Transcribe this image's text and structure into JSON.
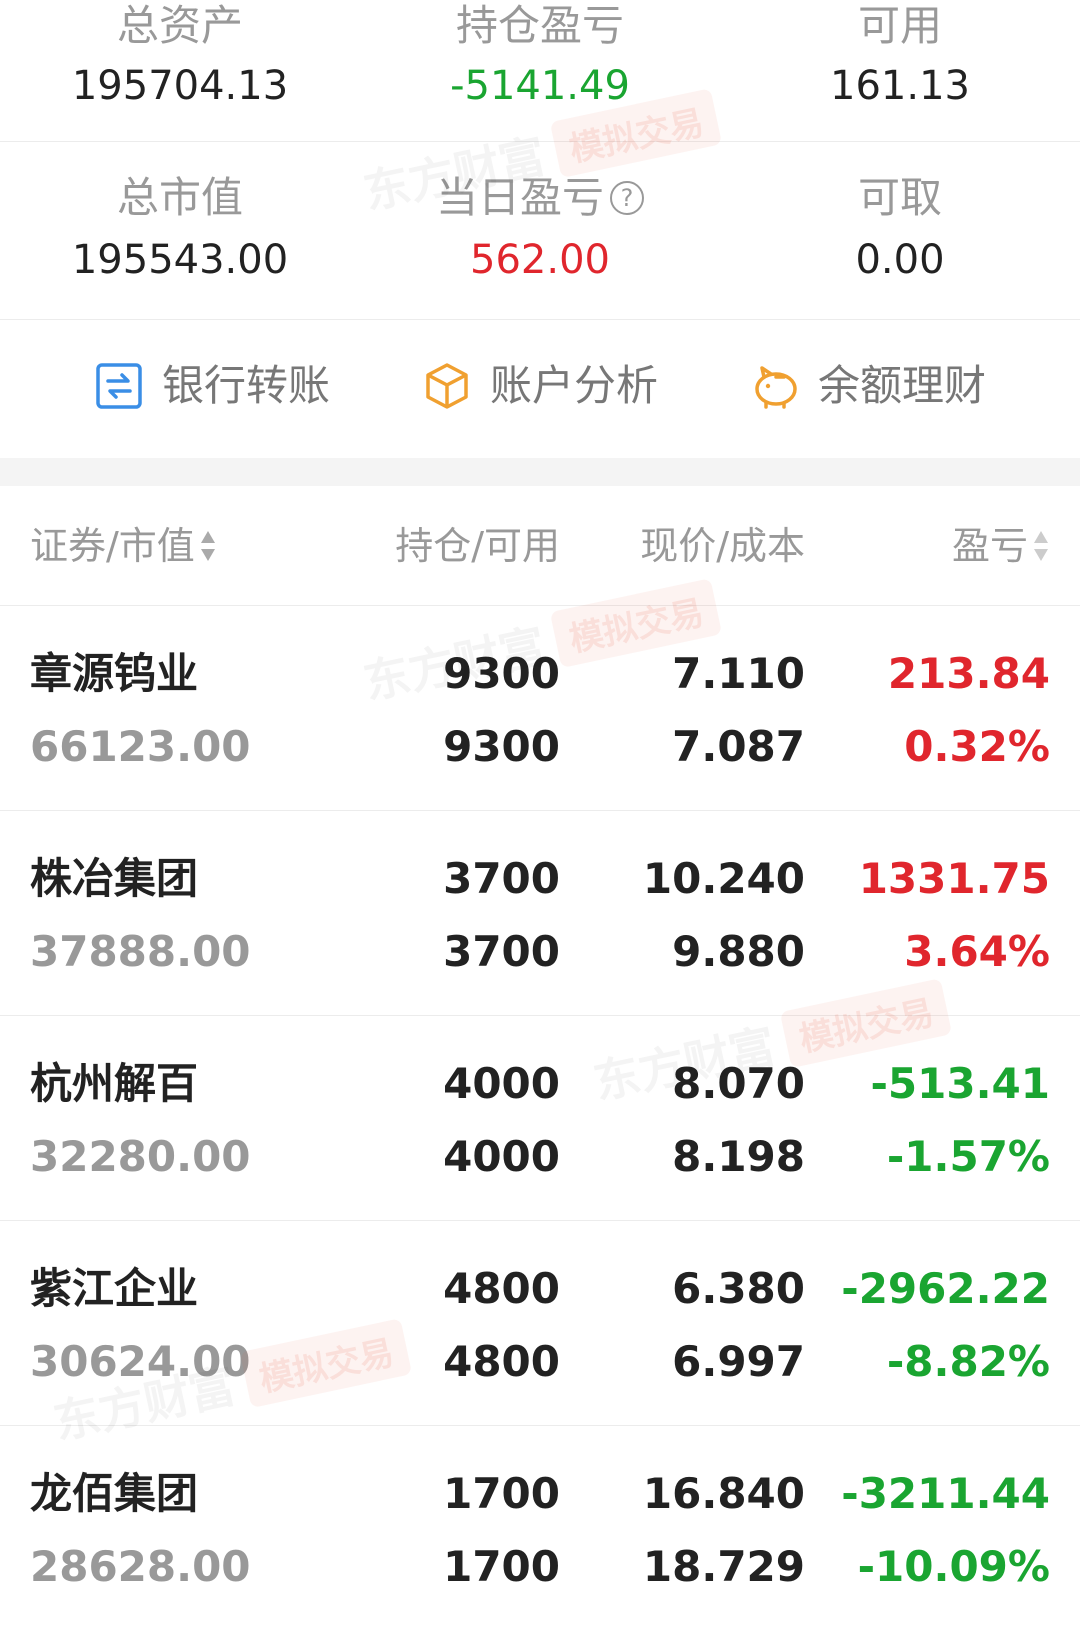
{
  "summary": {
    "total_assets": {
      "label": "总资产",
      "value": "195704.13"
    },
    "position_pnl": {
      "label": "持仓盈亏",
      "value": "-5141.49",
      "color": "#1aa531"
    },
    "available": {
      "label": "可用",
      "value": "161.13"
    },
    "total_market_value": {
      "label": "总市值",
      "value": "195543.00"
    },
    "daily_pnl": {
      "label": "当日盈亏",
      "value": "562.00",
      "color": "#e0262d",
      "icon": "help-icon"
    },
    "withdrawable": {
      "label": "可取",
      "value": "0.00"
    }
  },
  "actions": [
    {
      "label": "银行转账",
      "icon": "bank-transfer-icon",
      "color": "#3a8ee6"
    },
    {
      "label": "账户分析",
      "icon": "cube-icon",
      "color": "#f0a030"
    },
    {
      "label": "余额理财",
      "icon": "piggy-bank-icon",
      "color": "#f0a030"
    }
  ],
  "table": {
    "headers": {
      "security": "证券/市值",
      "position": "持仓/可用",
      "price": "现价/成本",
      "pnl": "盈亏"
    },
    "rows": [
      {
        "name": "章源钨业",
        "market_value": "66123.00",
        "position": "9300",
        "available": "9300",
        "price": "7.110",
        "cost": "7.087",
        "pnl": "213.84",
        "pnl_pct": "0.32%",
        "trend": "up"
      },
      {
        "name": "株冶集团",
        "market_value": "37888.00",
        "position": "3700",
        "available": "3700",
        "price": "10.240",
        "cost": "9.880",
        "pnl": "1331.75",
        "pnl_pct": "3.64%",
        "trend": "up"
      },
      {
        "name": "杭州解百",
        "market_value": "32280.00",
        "position": "4000",
        "available": "4000",
        "price": "8.070",
        "cost": "8.198",
        "pnl": "-513.41",
        "pnl_pct": "-1.57%",
        "trend": "down"
      },
      {
        "name": "紫江企业",
        "market_value": "30624.00",
        "position": "4800",
        "available": "4800",
        "price": "6.380",
        "cost": "6.997",
        "pnl": "-2962.22",
        "pnl_pct": "-8.82%",
        "trend": "down"
      },
      {
        "name": "龙佰集团",
        "market_value": "28628.00",
        "position": "1700",
        "available": "1700",
        "price": "16.840",
        "cost": "18.729",
        "pnl": "-3211.44",
        "pnl_pct": "-10.09%",
        "trend": "down"
      }
    ]
  },
  "watermark": {
    "brand": "东方财富",
    "tag": "模拟交易"
  },
  "colors": {
    "up": "#e0262d",
    "down": "#1aa531"
  }
}
